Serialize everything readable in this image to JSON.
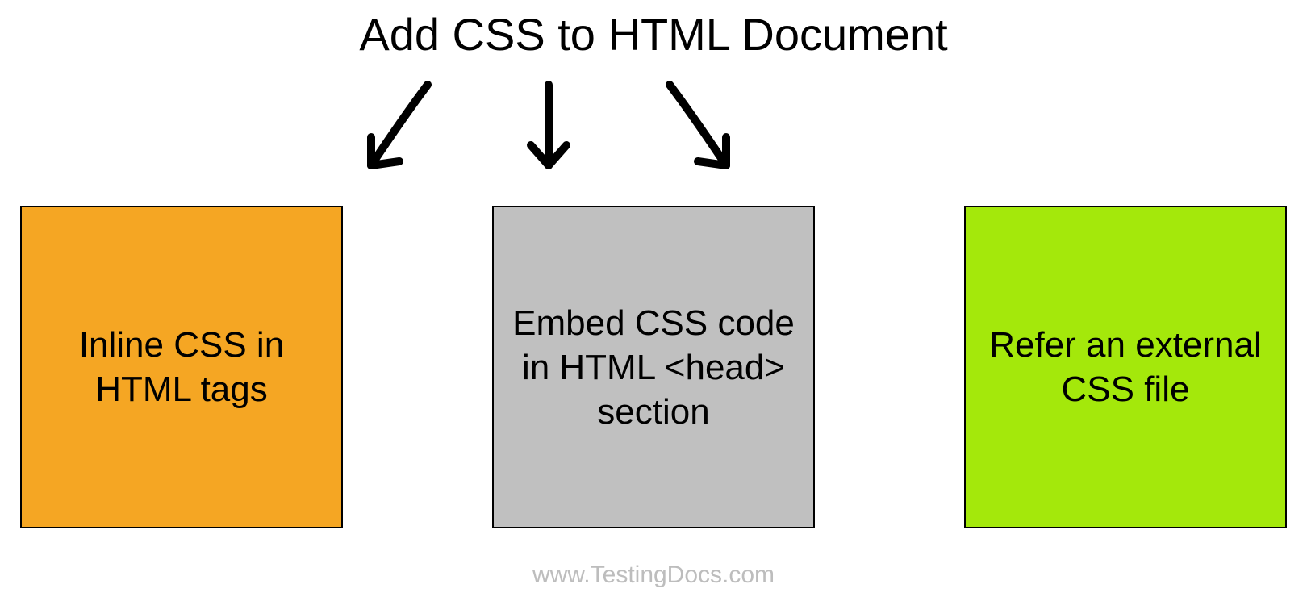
{
  "title": "Add CSS to HTML Document",
  "boxes": [
    {
      "label": "Inline CSS in HTML tags",
      "color": "#f5a623"
    },
    {
      "label": "Embed CSS code in HTML <head> section",
      "color": "#c0c0c0"
    },
    {
      "label": "Refer an external CSS file",
      "color": "#a4e80b"
    }
  ],
  "footer": "www.TestingDocs.com"
}
